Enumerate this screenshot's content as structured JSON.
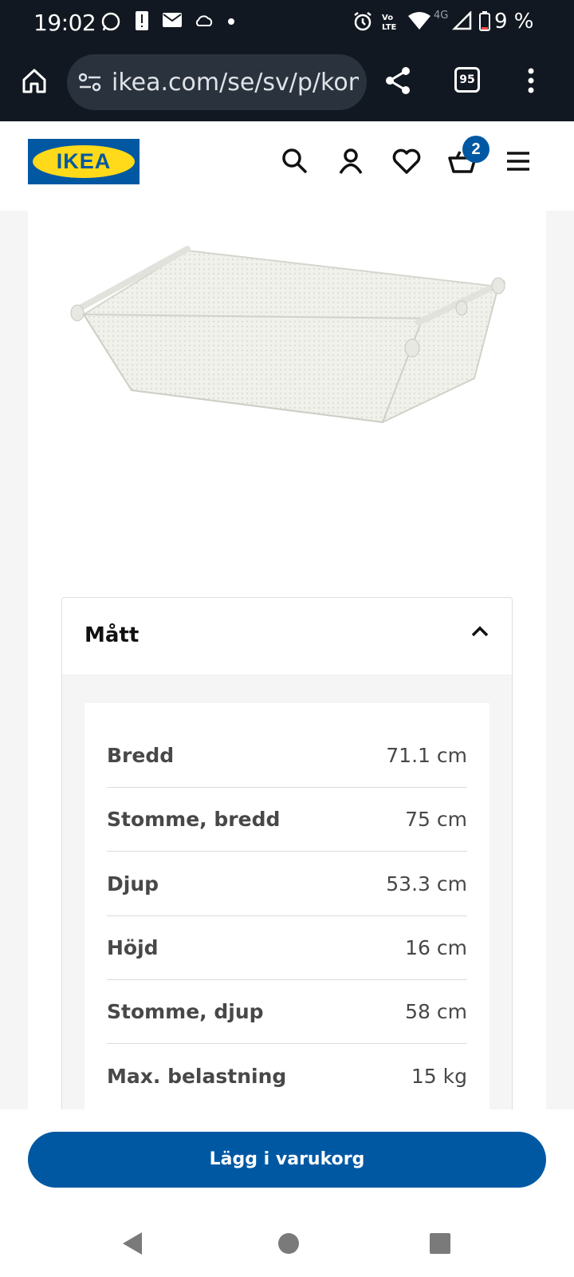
{
  "status_bar": {
    "time": "19:02",
    "network": "4G",
    "battery": "9 %"
  },
  "browser": {
    "url": "ikea.com/se/sv/p/komplement-nat",
    "tab_count": "95"
  },
  "header": {
    "logo_text": "IKEA",
    "cart_count": "2"
  },
  "accordion": {
    "title": "Mått",
    "rows": [
      {
        "label": "Bredd",
        "value": "71.1 cm"
      },
      {
        "label": "Stomme, bredd",
        "value": "75 cm"
      },
      {
        "label": "Djup",
        "value": "53.3 cm"
      },
      {
        "label": "Höjd",
        "value": "16 cm"
      },
      {
        "label": "Stomme, djup",
        "value": "58 cm"
      },
      {
        "label": "Max. belastning",
        "value": "15 kg"
      }
    ]
  },
  "footer": {
    "add_to_cart_label": "Lägg i varukorg"
  },
  "colors": {
    "ikea_blue": "#0058a3",
    "ikea_yellow": "#ffda1a",
    "status_bar_bg": "#121821"
  }
}
